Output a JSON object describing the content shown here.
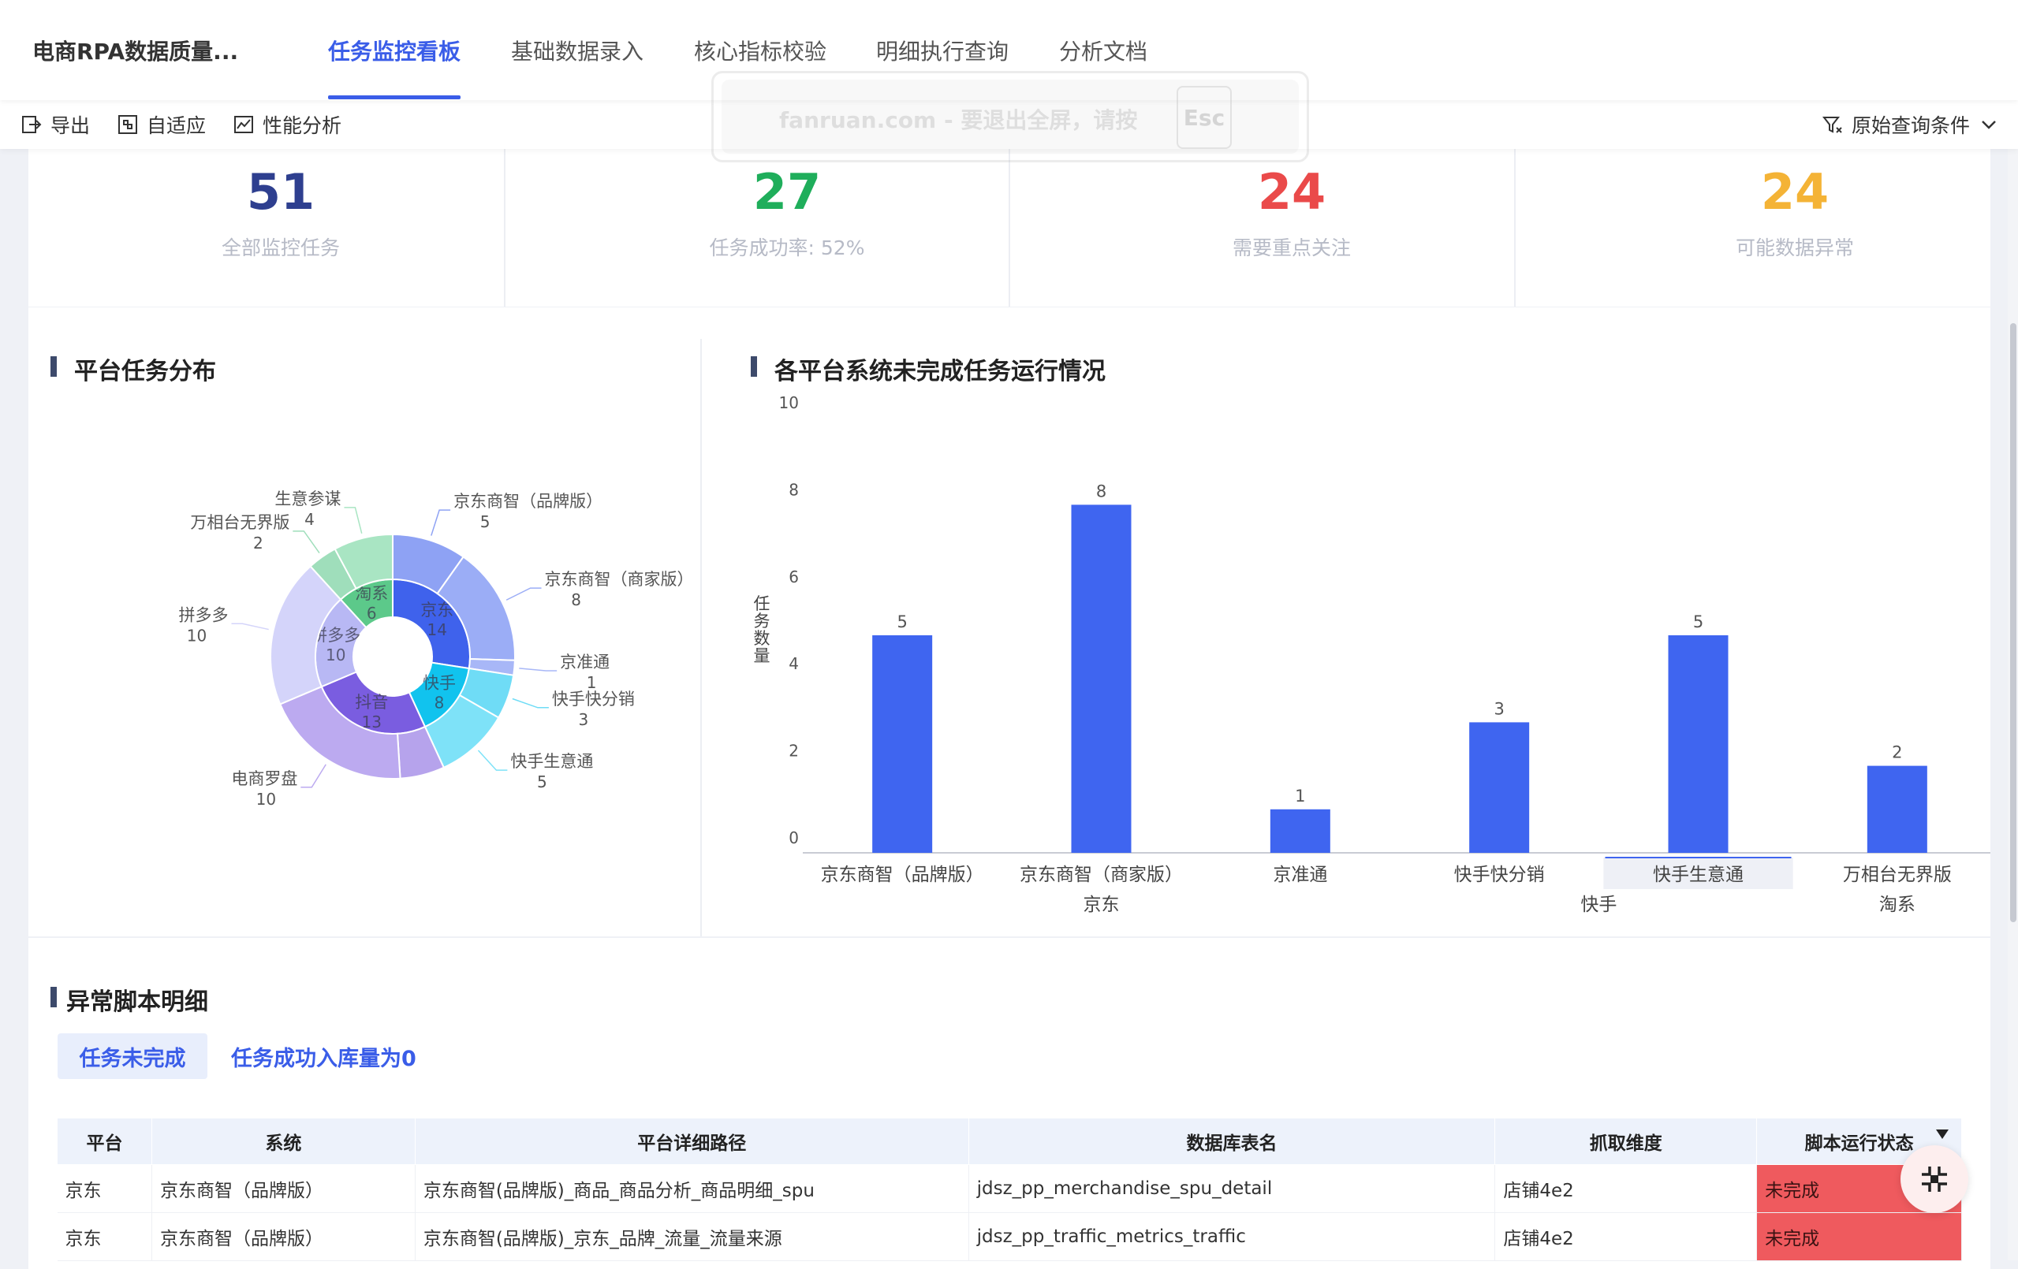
{
  "app": {
    "title": "电商RPA数据质量..."
  },
  "tabs": [
    {
      "label": "任务监控看板",
      "active": true
    },
    {
      "label": "基础数据录入"
    },
    {
      "label": "核心指标校验"
    },
    {
      "label": "明细执行查询"
    },
    {
      "label": "分析文档"
    }
  ],
  "fullscreen_tip": {
    "text": "fanruan.com - 要退出全屏，请按",
    "key": "Esc"
  },
  "toolbar": {
    "export": "导出",
    "fit": "自适应",
    "perf": "性能分析",
    "query": "原始查询条件"
  },
  "kpis": [
    {
      "value": "51",
      "label": "全部监控任务",
      "color": "#2e3f8f"
    },
    {
      "value": "27",
      "label": "任务成功率: 52%",
      "color": "#1fae5b"
    },
    {
      "value": "24",
      "label": "需要重点关注",
      "color": "#ea4a4a"
    },
    {
      "value": "24",
      "label": "可能数据异常",
      "color": "#f4b336"
    }
  ],
  "sections": {
    "pie_title": "平台任务分布",
    "bar_title": "各平台系统未完成任务运行情况",
    "table_title": "异常脚本明细"
  },
  "chart_data": [
    {
      "type": "pie",
      "subtype": "sunburst",
      "inner": [
        {
          "name": "京东",
          "value": 14,
          "color": "#3f62ec"
        },
        {
          "name": "快手",
          "value": 8,
          "color": "#11c3ee"
        },
        {
          "name": "抖音",
          "value": 13,
          "color": "#7a5de0"
        },
        {
          "name": "拼多多",
          "value": 10,
          "color": "#b8b8f4"
        },
        {
          "name": "淘系",
          "value": 6,
          "color": "#5cc98a"
        }
      ],
      "outer": [
        {
          "name": "京东商智（品牌版）",
          "value": 5,
          "parent": "京东",
          "color": "#8ea2f4"
        },
        {
          "name": "京东商智（商家版）",
          "value": 8,
          "parent": "京东",
          "color": "#9badf6"
        },
        {
          "name": "京准通",
          "value": 1,
          "parent": "京东",
          "color": "#a8b7f7"
        },
        {
          "name": "快手快分销",
          "value": 3,
          "parent": "快手",
          "color": "#6fdcf6"
        },
        {
          "name": "快手生意通",
          "value": 5,
          "parent": "快手",
          "color": "#7ee2f8"
        },
        {
          "name": "",
          "value": 3,
          "parent": "抖音",
          "color": "#b6a3ec"
        },
        {
          "name": "电商罗盘",
          "value": 10,
          "parent": "抖音",
          "color": "#bcaaf0"
        },
        {
          "name": "拼多多",
          "value": 10,
          "parent": "拼多多",
          "color": "#d4d4fa"
        },
        {
          "name": "万相台无界版",
          "value": 2,
          "parent": "淘系",
          "color": "#9fdebb"
        },
        {
          "name": "生意参谋",
          "value": 4,
          "parent": "淘系",
          "color": "#a9e5c3"
        }
      ]
    },
    {
      "type": "bar",
      "categories": [
        "京东商智（品牌版）",
        "京东商智（商家版）",
        "京准通",
        "快手快分销",
        "快手生意通",
        "万相台无界版"
      ],
      "groups": [
        {
          "name": "京东",
          "span": [
            0,
            2
          ]
        },
        {
          "name": "快手",
          "span": [
            3,
            4
          ]
        },
        {
          "name": "淘系",
          "span": [
            5,
            5
          ]
        }
      ],
      "values": [
        5,
        8,
        1,
        3,
        5,
        2
      ],
      "ylabel": "任务数量",
      "ylim": [
        0,
        10
      ],
      "yticks": [
        0,
        2,
        4,
        6,
        8,
        10
      ],
      "highlight_category": "快手生意通",
      "color": "#3f65f0",
      "grid": false
    }
  ],
  "table": {
    "subtabs": [
      "任务未完成",
      "任务成功入库量为0"
    ],
    "columns": [
      "平台",
      "系统",
      "平台详细路径",
      "数据库表名",
      "抓取维度",
      "脚本运行状态"
    ],
    "rows": [
      [
        "京东",
        "京东商智（品牌版）",
        "京东商智(品牌版)_商品_商品分析_商品明细_spu",
        "jdsz_pp_merchandise_spu_detail",
        "店铺4e2",
        "未完成"
      ],
      [
        "京东",
        "京东商智（品牌版）",
        "京东商智(品牌版)_京东_品牌_流量_流量来源",
        "jdsz_pp_traffic_metrics_traffic",
        "店铺4e2",
        "未完成"
      ]
    ]
  }
}
